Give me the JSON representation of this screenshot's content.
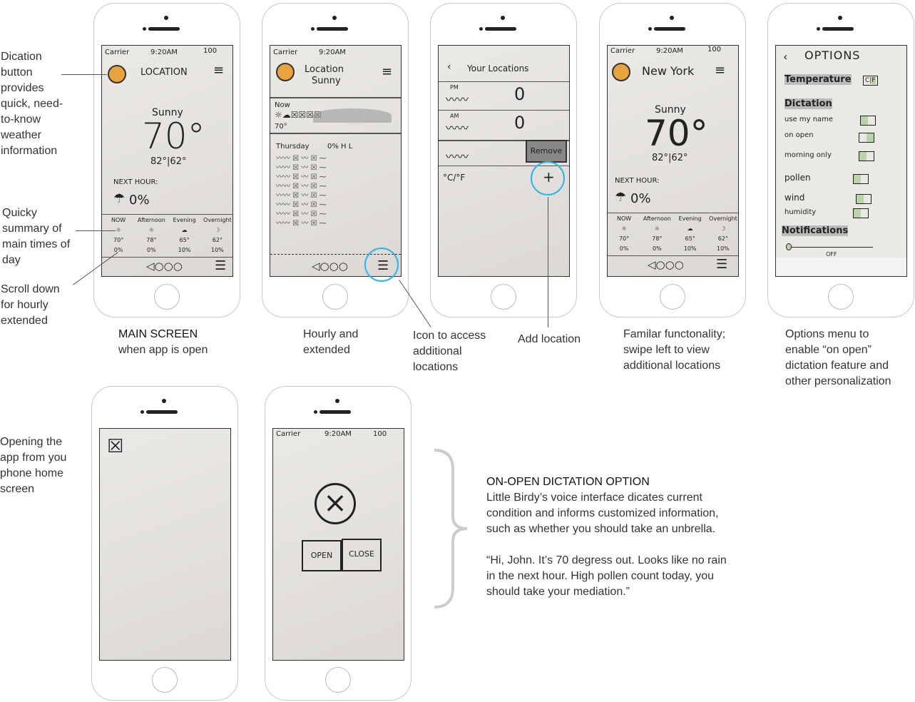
{
  "main_screen": {
    "status": "Carrier",
    "time": "9:20AM",
    "battery": "100",
    "location": "LOCATION",
    "condition": "Sunny",
    "temp": "70°",
    "hilo": "82°|62°",
    "next_hour_label": "NEXT HOUR:",
    "next_hour_precip": "0%",
    "periods": [
      {
        "name": "NOW",
        "temp": "70°",
        "precip": "0%"
      },
      {
        "name": "Afternoon",
        "temp": "78°",
        "precip": "0%"
      },
      {
        "name": "Evening",
        "temp": "65°",
        "precip": "10%"
      },
      {
        "name": "Overnight",
        "temp": "62°",
        "precip": "10%"
      }
    ],
    "pager": "◁○○○"
  },
  "hourly_screen": {
    "status": "Carrier",
    "time": "9:20AM",
    "location": "Location",
    "condition": "Sunny",
    "now": "Now",
    "temp": "70°",
    "day": "Thursday",
    "cols": "0% H L",
    "pager": "◁○○○"
  },
  "locations_screen": {
    "title": "Your Locations",
    "pm": "PM",
    "am": "AM",
    "temp": "0",
    "remove": "Remove",
    "units": "°C/°F",
    "add": "+"
  },
  "ny_screen": {
    "status": "Carrier",
    "time": "9:20AM",
    "battery": "100",
    "location": "New York",
    "condition": "Sunny",
    "temp": "70°",
    "hilo": "82°|62°",
    "next_hour_label": "NEXT HOUR:",
    "next_hour_precip": "0%",
    "pager": "◁○○○"
  },
  "options_screen": {
    "title": "OPTIONS",
    "temperature": "Temperature",
    "temp_c": "C",
    "temp_f": "F",
    "dictation": "Dictation",
    "items": [
      "use my name",
      "on open",
      "morning only",
      "pollen",
      "wind",
      "humidity"
    ],
    "notifications": "Notifications",
    "notif_value": "OFF"
  },
  "dialog_screen": {
    "status": "Carrier",
    "time": "9:20AM",
    "battery": "100",
    "open": "OPEN",
    "close": "CLOSE"
  },
  "annotations": {
    "dictation": "Dication button provides quick, need-to-know weather information",
    "summary": "Quicky summary of main times of day",
    "scroll": "Scroll down for hourly extended",
    "main_title": "MAIN SCREEN",
    "main_sub": "when app is open",
    "hourly": "Hourly and extended",
    "icon_access": "Icon to access additional locations",
    "add_location": "Add location",
    "familiar": "Familar functonality; swipe left to view additional locations",
    "options": "Options menu to enable “on open” dictation feature and other personalization",
    "opening": "Opening the app from you phone home screen",
    "onopen_title": "ON-OPEN DICTATION OPTION",
    "onopen_desc": "Little Birdy’s voice interface dicates current condition and informs customized information, such as whether you should take an unbrella.",
    "onopen_quote": "“Hi, John. It’s 70 degress out. Looks like no rain in the next hour. High pollen count today, you should take your mediation.”"
  },
  "colors": {
    "highlight": "#2bb5e6",
    "mic": "#e8a33c",
    "toggle": "#b8d4a8"
  }
}
